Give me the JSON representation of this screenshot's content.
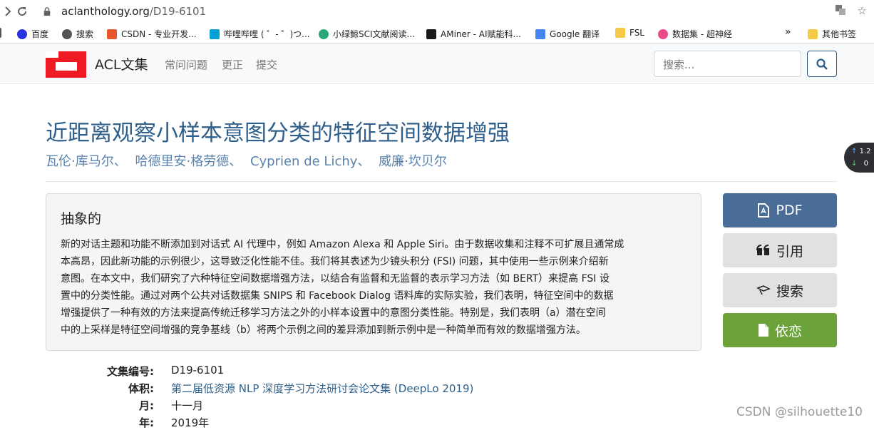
{
  "browser": {
    "url_host": "aclanthology.org",
    "url_path": "/D19-6101",
    "bookmarks": [
      {
        "label": "百度",
        "icon": "paw-icon",
        "color": "#2932e1"
      },
      {
        "label": "搜索",
        "icon": "globe-icon",
        "color": "#555555"
      },
      {
        "label": "CSDN - 专业开发...",
        "icon": "csdn-icon",
        "color": "#e4572e"
      },
      {
        "label": "哔哩哔哩 ( ゜- ゜)つ...",
        "icon": "bilibili-icon",
        "color": "#00a1d6"
      },
      {
        "label": "小绿鲸SCI文献阅读...",
        "icon": "whale-icon",
        "color": "#2aa775"
      },
      {
        "label": "AMiner - AI赋能科...",
        "icon": "aminer-icon",
        "color": "#1a1a1a"
      },
      {
        "label": "Google 翻译",
        "icon": "translate-icon",
        "color": "#4285f4"
      },
      {
        "label": "FSL",
        "icon": "folder-icon",
        "color": "#f7c948"
      },
      {
        "label": "数据集 - 超神经",
        "icon": "hyperai-icon",
        "color": "#e84a8a"
      },
      {
        "label": "其他书签",
        "icon": "folder-icon",
        "color": "#f7c948"
      }
    ],
    "more": "»"
  },
  "header": {
    "brand": "ACL文集",
    "nav": [
      "常问问题",
      "更正",
      "提交"
    ],
    "search_placeholder": "搜索..."
  },
  "paper": {
    "title": "近距离观察小样本意图分类的特征空间数据增强",
    "authors": [
      "瓦伦·库马尔、",
      "哈德里安·格劳德、",
      "Cyprien de Lichy、",
      "威廉·坎贝尔"
    ],
    "abstract_heading": "抽象的",
    "abstract_lines": [
      "新的对话主题和功能不断添加到对话式 AI 代理中，例如 Amazon Alexa 和 Apple Siri。由于数据收集和注释不可扩展且通常成",
      "本高昂，因此新功能的示例很少，这导致泛化性能不佳。我们将其表述为少镜头积分 (FSI) 问题，其中使用一些示例来介绍新",
      "意图。在本文中，我们研究了六种特征空间数据增强方法，以结合有监督和无监督的表示学习方法（如 BERT）来提高 FSI 设",
      "置中的分类性能。通过对两个公共对话数据集 SNIPS 和 Facebook Dialog 语料库的实际实验，我们表明，特征空间中的数据",
      "增强提供了一种有效的方法来提高传统迁移学习方法之外的小样本设置中的意图分类性能。特别是，我们表明（a）潜在空间",
      "中的上采样是特征空间增强的竞争基线（b）将两个示例之间的差异添加到新示例中是一种简单而有效的数据增强方法。"
    ]
  },
  "actions": {
    "pdf": "PDF",
    "cite": "引用",
    "search": "搜索",
    "dependency": "依恋"
  },
  "meta": {
    "id_label": "文集编号:",
    "id_value": "D19-6101",
    "volume_label": "体积:",
    "volume_value": "第二届低资源 NLP 深度学习方法研讨会论文集 (DeepLo 2019)",
    "month_label": "月:",
    "month_value": "十一月",
    "year_label": "年:",
    "year_value": "2019年"
  },
  "widget": {
    "up": "1.2",
    "down": "0"
  },
  "watermark": "CSDN @silhouette10",
  "colors": {
    "acl_red": "#ed1c24",
    "title_blue": "#2f5f8b",
    "pdf_blue": "#4a6d98",
    "dep_green": "#6ba33a"
  }
}
